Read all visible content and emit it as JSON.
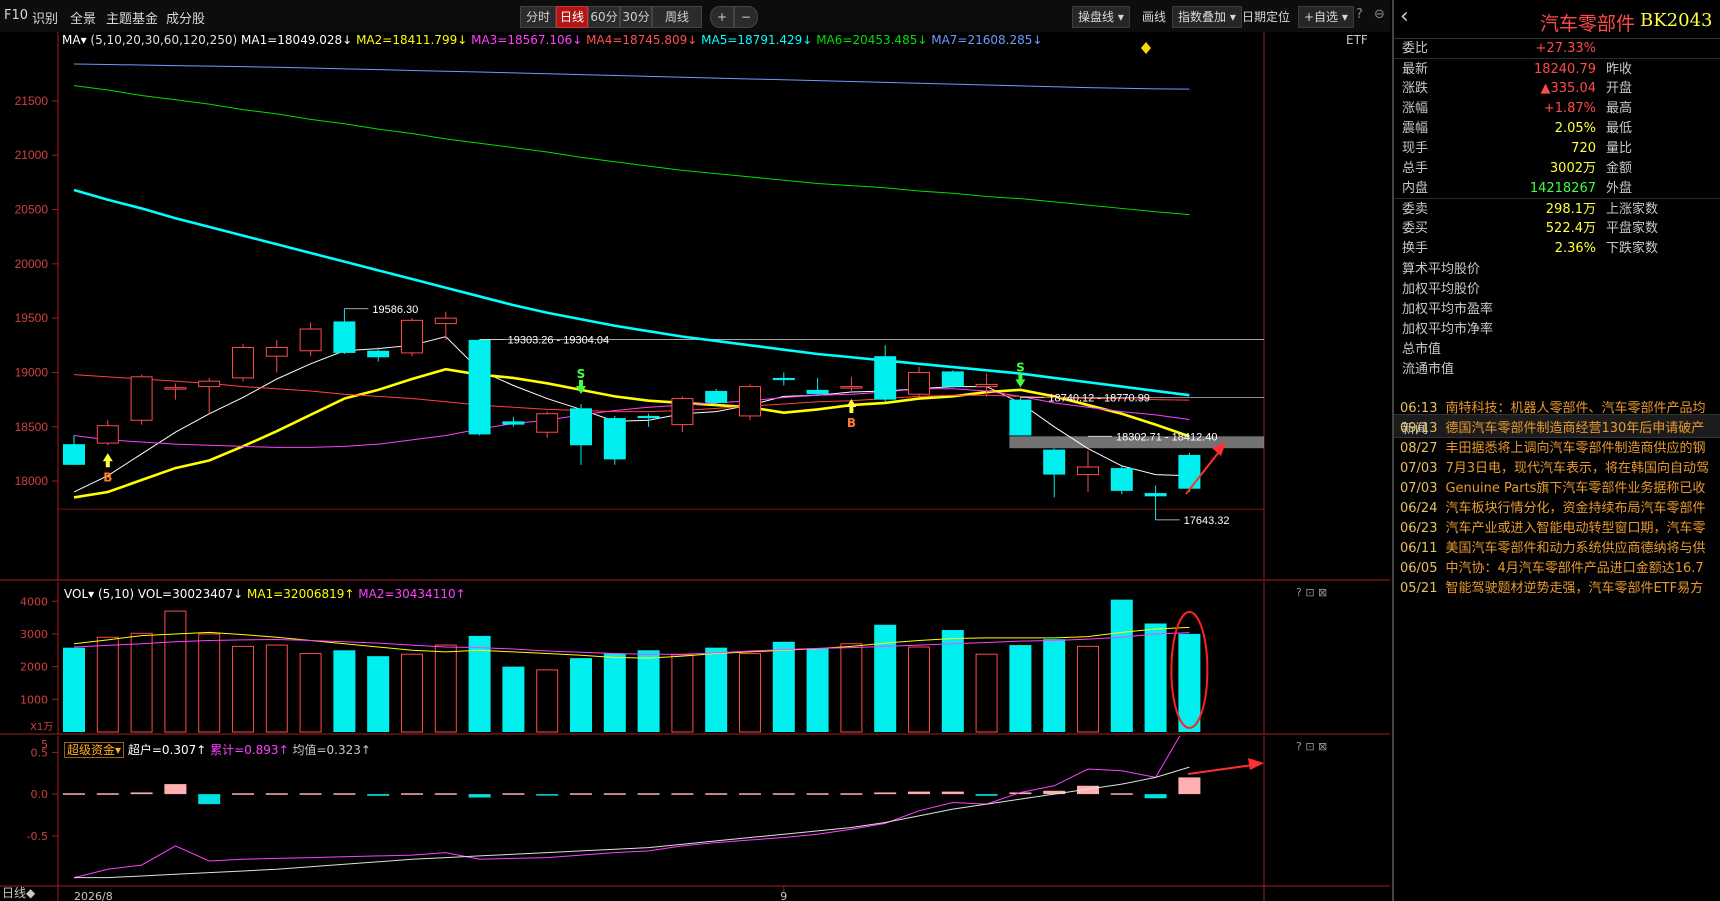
{
  "toolbar": {
    "left_items": [
      "F10",
      "识别",
      "全景",
      "主题基金",
      "成分股"
    ],
    "periods": [
      "分时",
      "日线",
      "60分",
      "30分",
      "周线"
    ],
    "active_period": "日线",
    "zoom_in": "+",
    "zoom_out": "−",
    "right_items": [
      "操盘线",
      "画线",
      "指数叠加",
      "日期定位",
      "+自选"
    ],
    "help": "?",
    "close": "⊖"
  },
  "ma_header": {
    "prefix": "MA▾",
    "params": "(5,10,20,30,60,120,250)",
    "items": [
      {
        "label": "MA1=18049.028↓",
        "color": "#ffffff"
      },
      {
        "label": "MA2=18411.799↓",
        "color": "#ffff00"
      },
      {
        "label": "MA3=18567.106↓",
        "color": "#ff40ff"
      },
      {
        "label": "MA4=18745.809↓",
        "color": "#ff4040"
      },
      {
        "label": "MA5=18791.429↓",
        "color": "#00ffff"
      },
      {
        "label": "MA6=20453.485↓",
        "color": "#00e000"
      },
      {
        "label": "MA7=21608.285↓",
        "color": "#6a9cff"
      }
    ],
    "etf": "ETF"
  },
  "colors": {
    "up": "#ff4a4a",
    "down": "#00f0f0",
    "bg": "#000000",
    "grid": "#7a1010",
    "axis": "#a02020"
  },
  "chart_data": [
    {
      "type": "candlestick",
      "ylim": [
        17550,
        21950
      ],
      "yticks": [
        18000,
        18500,
        19000,
        19500,
        20000,
        20500,
        21000,
        21500
      ],
      "x_labels": [
        {
          "index": 0,
          "text": "2026/8"
        },
        {
          "index": 21,
          "text": "9"
        }
      ],
      "candles": [
        {
          "o": 18150,
          "h": 18420,
          "l": 18150,
          "c": 18340,
          "d": 1
        },
        {
          "o": 18350,
          "h": 18560,
          "l": 18330,
          "c": 18510,
          "d": 0
        },
        {
          "o": 18560,
          "h": 18980,
          "l": 18520,
          "c": 18960,
          "d": 0
        },
        {
          "o": 18850,
          "h": 18900,
          "l": 18750,
          "c": 18860,
          "d": 0
        },
        {
          "o": 18870,
          "h": 18950,
          "l": 18620,
          "c": 18920,
          "d": 0
        },
        {
          "o": 18950,
          "h": 19260,
          "l": 18920,
          "c": 19230,
          "d": 0
        },
        {
          "o": 19150,
          "h": 19300,
          "l": 19000,
          "c": 19230,
          "d": 0
        },
        {
          "o": 19200,
          "h": 19460,
          "l": 19150,
          "c": 19400,
          "d": 0
        },
        {
          "o": 19470,
          "h": 19586.3,
          "l": 19170,
          "c": 19180,
          "d": 1
        },
        {
          "o": 19200,
          "h": 19230,
          "l": 19100,
          "c": 19140,
          "d": 1
        },
        {
          "o": 19180,
          "h": 19500,
          "l": 19150,
          "c": 19480,
          "d": 0
        },
        {
          "o": 19450,
          "h": 19560,
          "l": 19300,
          "c": 19500,
          "d": 0
        },
        {
          "o": 19300,
          "h": 19304.04,
          "l": 18420,
          "c": 18430,
          "d": 1
        },
        {
          "o": 18550,
          "h": 18590,
          "l": 18500,
          "c": 18520,
          "d": 1
        },
        {
          "o": 18450,
          "h": 18640,
          "l": 18400,
          "c": 18620,
          "d": 0
        },
        {
          "o": 18670,
          "h": 18710,
          "l": 18150,
          "c": 18330,
          "d": 1
        },
        {
          "o": 18200,
          "h": 18600,
          "l": 18150,
          "c": 18580,
          "d": 1
        },
        {
          "o": 18580,
          "h": 18620,
          "l": 18500,
          "c": 18600,
          "d": 1
        },
        {
          "o": 18520,
          "h": 18780,
          "l": 18450,
          "c": 18760,
          "d": 0
        },
        {
          "o": 18830,
          "h": 18850,
          "l": 18700,
          "c": 18720,
          "d": 1
        },
        {
          "o": 18600,
          "h": 18890,
          "l": 18560,
          "c": 18870,
          "d": 0
        },
        {
          "o": 18930,
          "h": 19000,
          "l": 18880,
          "c": 18950,
          "d": 1
        },
        {
          "o": 18840,
          "h": 18950,
          "l": 18790,
          "c": 18800,
          "d": 1
        },
        {
          "o": 18860,
          "h": 18960,
          "l": 18830,
          "c": 18870,
          "d": 0
        },
        {
          "o": 19150,
          "h": 19250,
          "l": 18730,
          "c": 18750,
          "d": 1
        },
        {
          "o": 18800,
          "h": 19050,
          "l": 18780,
          "c": 19000,
          "d": 0
        },
        {
          "o": 19010,
          "h": 19020,
          "l": 18860,
          "c": 18870,
          "d": 1
        },
        {
          "o": 18890,
          "h": 18990,
          "l": 18780,
          "c": 18870,
          "d": 0
        },
        {
          "o": 18750,
          "h": 18770.99,
          "l": 18420,
          "c": 18420,
          "d": 1
        },
        {
          "o": 18290,
          "h": 18300,
          "l": 17850,
          "c": 18060,
          "d": 1
        },
        {
          "o": 18060,
          "h": 18280,
          "l": 17900,
          "c": 18130,
          "d": 0
        },
        {
          "o": 18120,
          "h": 18150,
          "l": 17880,
          "c": 17910,
          "d": 1
        },
        {
          "o": 17860,
          "h": 17960,
          "l": 17643.32,
          "c": 17890,
          "d": 1
        },
        {
          "o": 17930,
          "h": 18260,
          "l": 17900,
          "c": 18240.79,
          "d": 1
        }
      ],
      "ma_lines": [
        {
          "name": "MA1",
          "color": "#ffffff",
          "values": [
            17900,
            18050,
            18250,
            18450,
            18620,
            18770,
            18940,
            19080,
            19200,
            19220,
            19250,
            19330,
            19020,
            18880,
            18760,
            18660,
            18550,
            18560,
            18620,
            18640,
            18700,
            18780,
            18790,
            18820,
            18830,
            18850,
            18870,
            18870,
            18720,
            18500,
            18300,
            18140,
            18060,
            18049
          ]
        },
        {
          "name": "MA2",
          "color": "#ffff00",
          "values": [
            17850,
            17900,
            18010,
            18120,
            18190,
            18320,
            18460,
            18610,
            18760,
            18840,
            18940,
            19030,
            18980,
            18950,
            18900,
            18840,
            18780,
            18740,
            18720,
            18700,
            18680,
            18630,
            18660,
            18700,
            18720,
            18760,
            18780,
            18820,
            18840,
            18780,
            18700,
            18620,
            18520,
            18412
          ]
        },
        {
          "name": "MA3",
          "color": "#ff40ff",
          "values": [
            18420,
            18380,
            18360,
            18340,
            18330,
            18320,
            18310,
            18310,
            18320,
            18340,
            18380,
            18420,
            18480,
            18530,
            18560,
            18610,
            18650,
            18680,
            18700,
            18720,
            18740,
            18770,
            18790,
            18800,
            18820,
            18850,
            18850,
            18830,
            18780,
            18720,
            18680,
            18640,
            18610,
            18567
          ]
        },
        {
          "name": "MA4",
          "color": "#ff4040",
          "values": [
            18980,
            18960,
            18940,
            18920,
            18900,
            18870,
            18850,
            18830,
            18800,
            18780,
            18760,
            18730,
            18700,
            18680,
            18660,
            18650,
            18640,
            18640,
            18650,
            18670,
            18690,
            18710,
            18730,
            18740,
            18760,
            18780,
            18790,
            18790,
            18780,
            18770,
            18760,
            18760,
            18750,
            18746
          ]
        },
        {
          "name": "MA5",
          "color": "#00ffff",
          "values": [
            20680,
            20590,
            20510,
            20420,
            20340,
            20260,
            20180,
            20100,
            20020,
            19940,
            19860,
            19780,
            19700,
            19620,
            19550,
            19490,
            19430,
            19380,
            19330,
            19290,
            19250,
            19210,
            19170,
            19140,
            19110,
            19080,
            19050,
            19020,
            18990,
            18950,
            18910,
            18870,
            18830,
            18791
          ]
        },
        {
          "name": "MA6",
          "color": "#00e000",
          "values": [
            21640,
            21600,
            21550,
            21510,
            21470,
            21420,
            21380,
            21330,
            21290,
            21240,
            21200,
            21150,
            21110,
            21070,
            21030,
            20980,
            20940,
            20900,
            20860,
            20830,
            20800,
            20770,
            20740,
            20720,
            20700,
            20670,
            20650,
            20620,
            20600,
            20570,
            20540,
            20510,
            20480,
            20453
          ]
        },
        {
          "name": "MA7",
          "color": "#6a9cff",
          "values": [
            21840,
            21835,
            21830,
            21825,
            21820,
            21815,
            21810,
            21803,
            21795,
            21788,
            21780,
            21773,
            21766,
            21758,
            21750,
            21742,
            21734,
            21726,
            21718,
            21710,
            21702,
            21694,
            21686,
            21678,
            21670,
            21662,
            21654,
            21646,
            21638,
            21630,
            21622,
            21616,
            21611,
            21608
          ]
        }
      ],
      "annotations": [
        {
          "index": 8,
          "price": 19586.3,
          "text": "19586.30"
        },
        {
          "index": 12,
          "price": 19304.04,
          "text": "19303.26 - 19304.04"
        },
        {
          "index": 28,
          "price": 18770.99,
          "text": "18740.12 - 18770.99"
        },
        {
          "index": 32,
          "price": 17643.32,
          "text": "17643.32"
        },
        {
          "index": 30,
          "price": 18412.4,
          "text": "18302.71 - 18412.40"
        }
      ],
      "signals": [
        {
          "index": 1,
          "type": "B"
        },
        {
          "index": 15,
          "type": "S"
        },
        {
          "index": 23,
          "type": "B"
        },
        {
          "index": 28,
          "type": "S"
        }
      ]
    },
    {
      "type": "bar",
      "name": "VOL",
      "header": "VOL▾ (5,10)",
      "items": [
        {
          "label": "VOL=30023407↓",
          "color": "#ffffff"
        },
        {
          "label": "MA1=32006819↑",
          "color": "#ffff00"
        },
        {
          "label": "MA2=30434110↑",
          "color": "#ff40ff"
        }
      ],
      "unit": "X1万",
      "ylim": [
        0,
        4100
      ],
      "yticks": [
        1000,
        2000,
        3000,
        4000
      ],
      "values": [
        2580,
        2900,
        3020,
        3700,
        3000,
        2620,
        2660,
        2400,
        2500,
        2320,
        2380,
        2660,
        2940,
        2000,
        1900,
        2260,
        2400,
        2500,
        2360,
        2580,
        2400,
        2760,
        2560,
        2700,
        3280,
        2600,
        3120,
        2380,
        2660,
        2840,
        2620,
        4050,
        3320,
        3002
      ],
      "ma1": [
        2700,
        2820,
        2950,
        3000,
        3050,
        2980,
        2900,
        2800,
        2700,
        2600,
        2500,
        2450,
        2500,
        2450,
        2400,
        2350,
        2280,
        2260,
        2320,
        2400,
        2450,
        2500,
        2550,
        2620,
        2720,
        2800,
        2860,
        2880,
        2880,
        2880,
        2920,
        3050,
        3150,
        3200
      ],
      "ma2": [
        2600,
        2650,
        2700,
        2760,
        2800,
        2820,
        2830,
        2800,
        2760,
        2720,
        2660,
        2600,
        2580,
        2540,
        2480,
        2440,
        2400,
        2380,
        2380,
        2420,
        2480,
        2520,
        2560,
        2580,
        2620,
        2660,
        2700,
        2740,
        2780,
        2800,
        2840,
        2900,
        3000,
        3040
      ]
    },
    {
      "type": "bar",
      "name": "超级资金",
      "header": "超级资金▾",
      "items": [
        {
          "label": "超户=0.307↑",
          "color": "#ffffff"
        },
        {
          "label": "累计=0.893↑",
          "color": "#ff40ff"
        },
        {
          "label": "均值=0.323↑",
          "color": "#c8c8c8"
        }
      ],
      "ylim": [
        -1.1,
        0.6
      ],
      "yticks": [
        -0.5,
        0.0,
        0.5
      ],
      "ytick_labels": [
        "-0.5",
        "0.0",
        "0.5"
      ],
      "top_label": "5",
      "values": [
        0.01,
        0.01,
        0.02,
        0.12,
        -0.12,
        0.01,
        0.01,
        0.01,
        0.01,
        -0.02,
        0.01,
        0.01,
        -0.04,
        0.01,
        -0.01,
        0.01,
        0.01,
        0.01,
        0.01,
        0.01,
        0.01,
        0.01,
        0.01,
        0.01,
        0.02,
        0.03,
        0.03,
        -0.02,
        0.02,
        0.04,
        0.1,
        0.01,
        -0.05,
        0.2
      ],
      "cumulative": [
        -1.0,
        -0.9,
        -0.85,
        -0.62,
        -0.8,
        -0.78,
        -0.77,
        -0.76,
        -0.75,
        -0.74,
        -0.73,
        -0.7,
        -0.78,
        -0.77,
        -0.76,
        -0.73,
        -0.7,
        -0.68,
        -0.62,
        -0.58,
        -0.55,
        -0.52,
        -0.48,
        -0.42,
        -0.35,
        -0.2,
        -0.1,
        -0.12,
        0.02,
        0.1,
        0.3,
        0.28,
        0.2,
        0.893
      ],
      "average": [
        -1.0,
        -1.0,
        -0.98,
        -0.96,
        -0.94,
        -0.92,
        -0.9,
        -0.87,
        -0.84,
        -0.81,
        -0.78,
        -0.76,
        -0.74,
        -0.72,
        -0.7,
        -0.68,
        -0.66,
        -0.64,
        -0.6,
        -0.56,
        -0.52,
        -0.48,
        -0.44,
        -0.4,
        -0.34,
        -0.26,
        -0.18,
        -0.12,
        -0.06,
        0.0,
        0.06,
        0.12,
        0.2,
        0.323
      ]
    }
  ],
  "bottom_bar": {
    "label": "日线◆",
    "date_label": "2026/8",
    "mid_label": "9"
  },
  "side": {
    "back": "‹",
    "title": "汽车零部件",
    "code": "BK2043",
    "quotes": [
      {
        "label": "委比",
        "value": "+27.33%",
        "color": "#ff4a4a",
        "label2": ""
      },
      {
        "label": "最新",
        "value": "18240.79",
        "color": "#ff4a4a",
        "label2": "昨收"
      },
      {
        "label": "涨跌",
        "value": "▲335.04",
        "color": "#ff4a4a",
        "label2": "开盘"
      },
      {
        "label": "涨幅",
        "value": "+1.87%",
        "color": "#ff4a4a",
        "label2": "最高"
      },
      {
        "label": "震幅",
        "value": "2.05%",
        "color": "#ffff40",
        "label2": "最低"
      },
      {
        "label": "现手",
        "value": "720",
        "color": "#ffff40",
        "label2": "量比"
      },
      {
        "label": "总手",
        "value": "3002万",
        "color": "#ffff40",
        "label2": "金额"
      },
      {
        "label": "内盘",
        "value": "14218267",
        "color": "#40ff40",
        "label2": "外盘"
      },
      {
        "label": "委卖",
        "value": "298.1万",
        "color": "#ffff40",
        "label2": "上涨家数"
      },
      {
        "label": "委买",
        "value": "522.4万",
        "color": "#ffff40",
        "label2": "平盘家数"
      },
      {
        "label": "换手",
        "value": "2.36%",
        "color": "#ffff40",
        "label2": "下跌家数"
      }
    ],
    "extra_rows": [
      "算术平均股价",
      "加权平均股价",
      "加权平均市盈率",
      "加权平均市净率",
      "总市值",
      "流通市值"
    ],
    "news_title": "新闻",
    "news": [
      {
        "date": "06:13",
        "text": "南特科技：机器人零部件、汽车零部件产品均"
      },
      {
        "date": "09/13",
        "text": "德国汽车零部件制造商经营130年后申请破产"
      },
      {
        "date": "08/27",
        "text": "丰田据悉将上调向汽车零部件制造商供应的钢"
      },
      {
        "date": "07/03",
        "text": "7月3日电，现代汽车表示，将在韩国向自动驾"
      },
      {
        "date": "07/03",
        "text": "Genuine Parts旗下汽车零部件业务据称已收"
      },
      {
        "date": "06/24",
        "text": "汽车板块行情分化，资金持续布局汽车零部件"
      },
      {
        "date": "06/23",
        "text": "汽车产业或进入智能电动转型窗口期，汽车零"
      },
      {
        "date": "06/11",
        "text": "美国汽车零部件和动力系统供应商德纳将与供"
      },
      {
        "date": "06/05",
        "text": "中汽协：4月汽车零部件产品进口金额达16.7"
      },
      {
        "date": "05/21",
        "text": "智能驾驶题材逆势走强，汽车零部件ETF易方"
      }
    ]
  }
}
